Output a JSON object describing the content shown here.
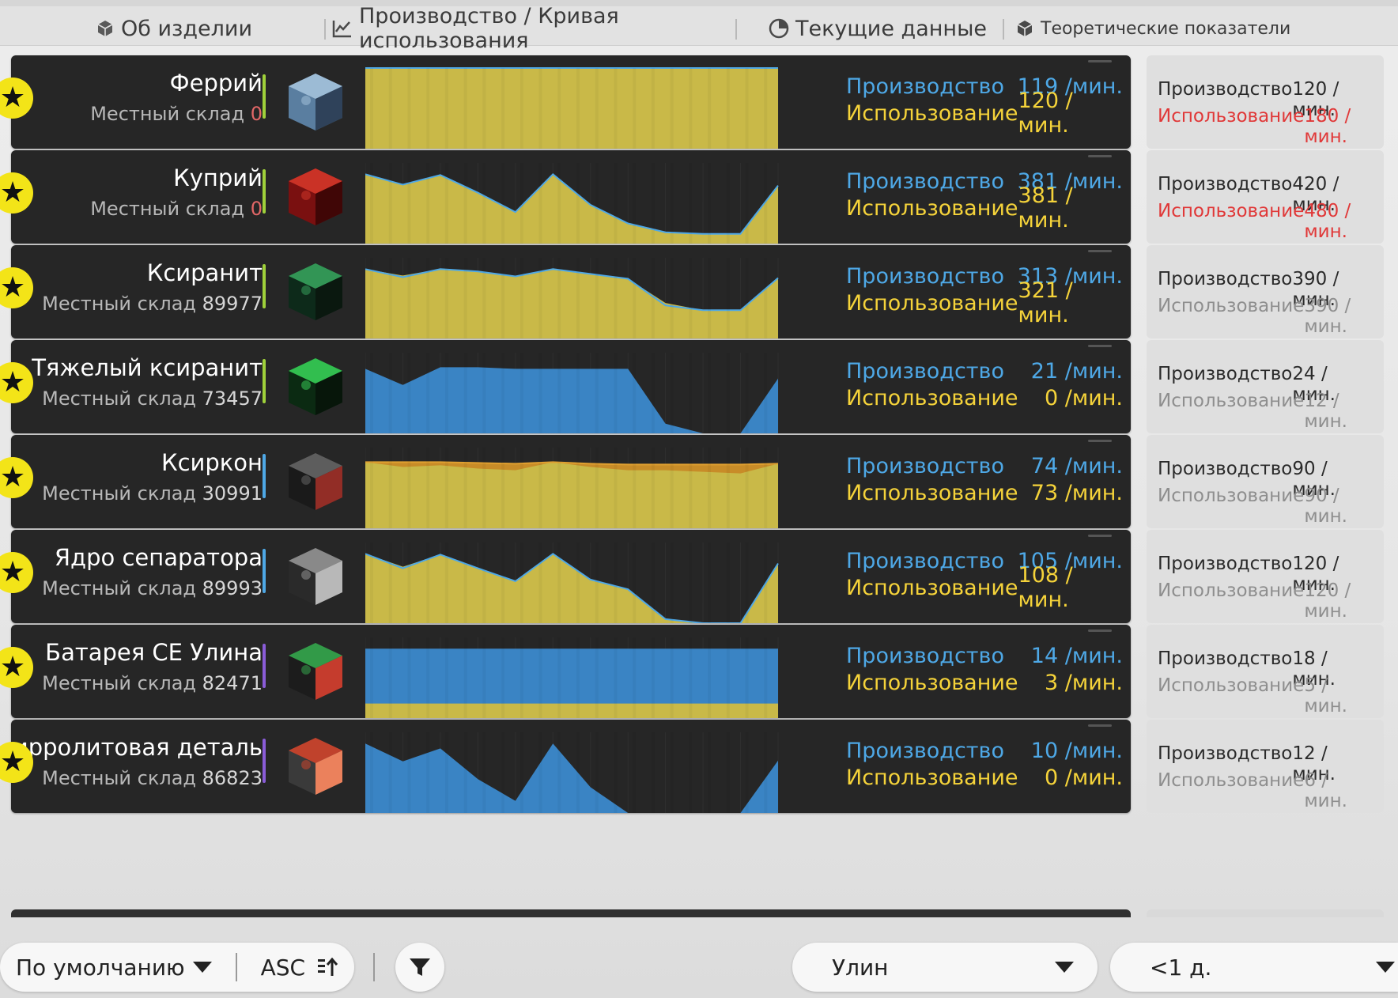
{
  "header": {
    "col_item": "Об изделии",
    "col_curve": "Производство / Кривая использования",
    "col_current": "Текущие данные",
    "col_theory": "Теоретические показатели"
  },
  "labels": {
    "production": "Производство",
    "usage": "Использование",
    "per_min": "/мин.",
    "stock": "Местный склад"
  },
  "rows": [
    {
      "name": "Феррий",
      "stock": "0",
      "stock_zero": true,
      "bar_color": "#9fd13a",
      "prod": "119",
      "use": "120",
      "t_prod": "120",
      "t_use": "180",
      "t_warn": true,
      "chart_mode": "yellow",
      "yellow": [
        1,
        1,
        1,
        1,
        1,
        1,
        1,
        1,
        1,
        1,
        1,
        1
      ],
      "blue": [
        1,
        1,
        1,
        1,
        1,
        1,
        1,
        1,
        1,
        1,
        1,
        1
      ]
    },
    {
      "name": "Куприй",
      "stock": "0",
      "stock_zero": true,
      "bar_color": "#9fd13a",
      "prod": "381",
      "use": "381",
      "t_prod": "420",
      "t_use": "480",
      "t_warn": true,
      "chart_mode": "yellow",
      "yellow": [
        0.86,
        0.73,
        0.85,
        0.63,
        0.39,
        0.86,
        0.48,
        0.25,
        0.14,
        0.12,
        0.12,
        0.72
      ],
      "blue": [
        0.86,
        0.73,
        0.85,
        0.63,
        0.39,
        0.86,
        0.48,
        0.25,
        0.14,
        0.12,
        0.12,
        0.72
      ]
    },
    {
      "name": "Ксиранит",
      "stock": "89977",
      "stock_zero": false,
      "bar_color": "#9fd13a",
      "prod": "313",
      "use": "321",
      "t_prod": "390",
      "t_use": "390",
      "t_warn": false,
      "chart_mode": "yellow",
      "yellow": [
        0.86,
        0.78,
        0.86,
        0.83,
        0.77,
        0.86,
        0.8,
        0.74,
        0.44,
        0.35,
        0.35,
        0.75
      ],
      "blue": [
        0.86,
        0.76,
        0.86,
        0.83,
        0.77,
        0.86,
        0.8,
        0.74,
        0.41,
        0.35,
        0.35,
        0.75
      ]
    },
    {
      "name": "Тяжелый ксиранит",
      "stock": "73457",
      "stock_zero": false,
      "bar_color": "#9fd13a",
      "prod": "21",
      "use": "0",
      "t_prod": "24",
      "t_use": "12",
      "t_warn": false,
      "chart_mode": "blue",
      "yellow": [
        0,
        0,
        0,
        0,
        0,
        0,
        0,
        0,
        0,
        0,
        0,
        0
      ],
      "blue": [
        0.8,
        0.6,
        0.82,
        0.82,
        0.8,
        0.8,
        0.8,
        0.8,
        0.12,
        0,
        0,
        0.68
      ]
    },
    {
      "name": "Ксиркон",
      "stock": "30991",
      "stock_zero": false,
      "bar_color": "#4ea8e6",
      "prod": "74",
      "use": "73",
      "t_prod": "90",
      "t_use": "90",
      "t_warn": false,
      "chart_mode": "mixed",
      "yellow": [
        0.82,
        0.76,
        0.78,
        0.74,
        0.72,
        0.82,
        0.76,
        0.72,
        0.72,
        0.7,
        0.68,
        0.8
      ],
      "blue": [
        0.82,
        0.82,
        0.82,
        0.81,
        0.8,
        0.82,
        0.8,
        0.79,
        0.79,
        0.79,
        0.79,
        0.8
      ]
    },
    {
      "name": "Ядро сепаратора",
      "stock": "89993",
      "stock_zero": false,
      "bar_color": "#4ea8e6",
      "prod": "105",
      "use": "108",
      "t_prod": "120",
      "t_use": "120",
      "t_warn": false,
      "chart_mode": "yellow",
      "yellow": [
        0.86,
        0.7,
        0.85,
        0.68,
        0.52,
        0.86,
        0.54,
        0.42,
        0.05,
        0,
        0,
        0.74
      ],
      "blue": [
        0.86,
        0.68,
        0.85,
        0.68,
        0.52,
        0.86,
        0.54,
        0.42,
        0.05,
        0,
        0,
        0.74
      ]
    },
    {
      "name": "Батарея CE Улина",
      "stock": "82471",
      "stock_zero": false,
      "bar_color": "#8a5cd8",
      "prod": "14",
      "use": "3",
      "t_prod": "18",
      "t_use": "5",
      "t_warn": false,
      "chart_mode": "flat",
      "yellow": [
        0.18,
        0.18,
        0.18,
        0.18,
        0.18,
        0.18,
        0.18,
        0.18,
        0.18,
        0.18,
        0.18,
        0.18
      ],
      "blue": [
        0.86,
        0.86,
        0.86,
        0.86,
        0.86,
        0.86,
        0.86,
        0.86,
        0.86,
        0.86,
        0.86,
        0.86
      ]
    },
    {
      "name": "Пирролитовая деталь",
      "stock": "86823",
      "stock_zero": false,
      "bar_color": "#8a5cd8",
      "prod": "10",
      "use": "0",
      "t_prod": "12",
      "t_use": "6",
      "t_warn": false,
      "chart_mode": "blue",
      "yellow": [
        0,
        0,
        0,
        0,
        0,
        0,
        0,
        0,
        0,
        0,
        0,
        0
      ],
      "blue": [
        0.86,
        0.64,
        0.8,
        0.42,
        0.15,
        0.86,
        0.32,
        0,
        0,
        0,
        0,
        0.65
      ]
    }
  ],
  "bottom": {
    "sort": "По умолчанию",
    "order": "ASC",
    "region": "Улин",
    "period": "<1 д."
  }
}
